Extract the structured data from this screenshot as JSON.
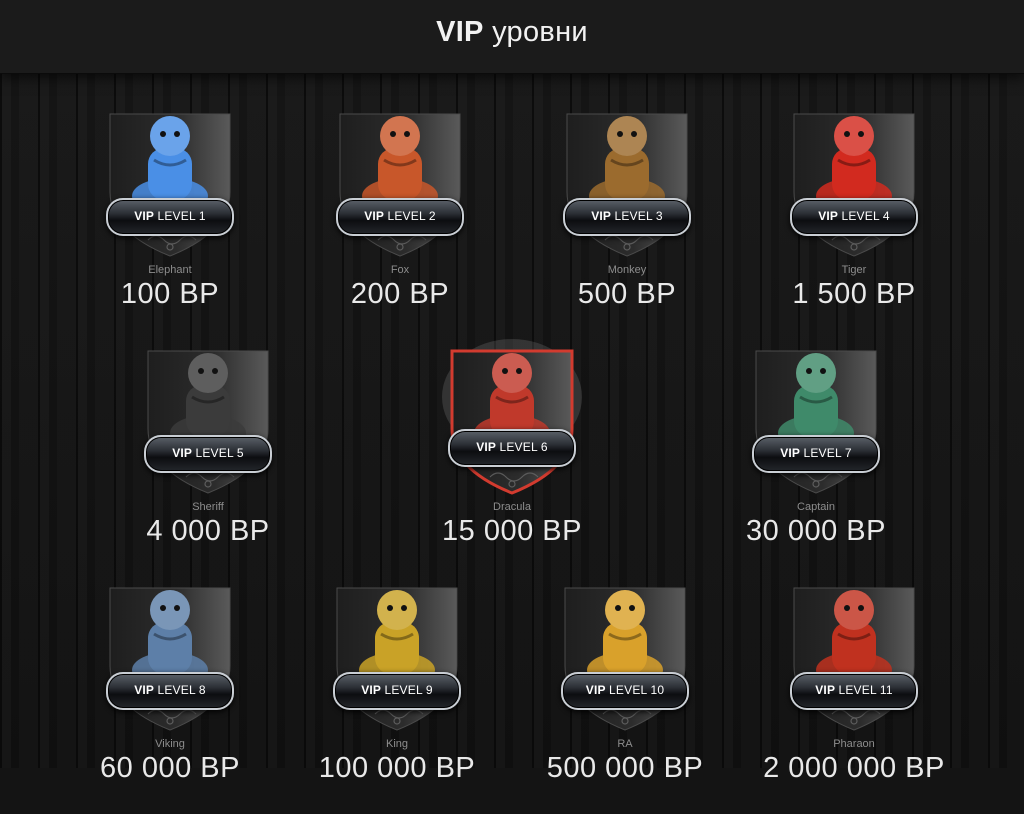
{
  "header": {
    "title_bold": "VIP",
    "title_rest": "уровни"
  },
  "levels": [
    {
      "badge_prefix": "VIP",
      "badge_text": "LEVEL 1",
      "name": "Elephant",
      "price": "100 BP",
      "icon": "elephant-icon",
      "accent": "#4a8fe6",
      "active": false
    },
    {
      "badge_prefix": "VIP",
      "badge_text": "LEVEL 2",
      "name": "Fox",
      "price": "200 BP",
      "icon": "fox-icon",
      "accent": "#c8572a",
      "active": false
    },
    {
      "badge_prefix": "VIP",
      "badge_text": "LEVEL 3",
      "name": "Monkey",
      "price": "500 BP",
      "icon": "monkey-icon",
      "accent": "#9b6b2e",
      "active": false
    },
    {
      "badge_prefix": "VIP",
      "badge_text": "LEVEL 4",
      "name": "Tiger",
      "price": "1 500 BP",
      "icon": "tiger-icon",
      "accent": "#d22a1f",
      "active": false
    },
    {
      "badge_prefix": "VIP",
      "badge_text": "LEVEL 5",
      "name": "Sheriff",
      "price": "4 000 BP",
      "icon": "sheriff-icon",
      "accent": "#3b3b3b",
      "active": false
    },
    {
      "badge_prefix": "VIP",
      "badge_text": "LEVEL 6",
      "name": "Dracula",
      "price": "15 000 BP",
      "icon": "dracula-icon",
      "accent": "#c0392b",
      "active": true
    },
    {
      "badge_prefix": "VIP",
      "badge_text": "LEVEL 7",
      "name": "Captain",
      "price": "30 000 BP",
      "icon": "captain-icon",
      "accent": "#3f8a6a",
      "active": false
    },
    {
      "badge_prefix": "VIP",
      "badge_text": "LEVEL 8",
      "name": "Viking",
      "price": "60 000 BP",
      "icon": "viking-icon",
      "accent": "#5d7fa8",
      "active": false
    },
    {
      "badge_prefix": "VIP",
      "badge_text": "LEVEL 9",
      "name": "King",
      "price": "100 000 BP",
      "icon": "king-icon",
      "accent": "#c9a227",
      "active": false
    },
    {
      "badge_prefix": "VIP",
      "badge_text": "LEVEL 10",
      "name": "RA",
      "price": "500 000 BP",
      "icon": "ra-icon",
      "accent": "#d9a12b",
      "active": false
    },
    {
      "badge_prefix": "VIP",
      "badge_text": "LEVEL 11",
      "name": "Pharaon",
      "price": "2 000 000 BP",
      "icon": "pharaon-icon",
      "accent": "#c0311f",
      "active": false
    }
  ]
}
